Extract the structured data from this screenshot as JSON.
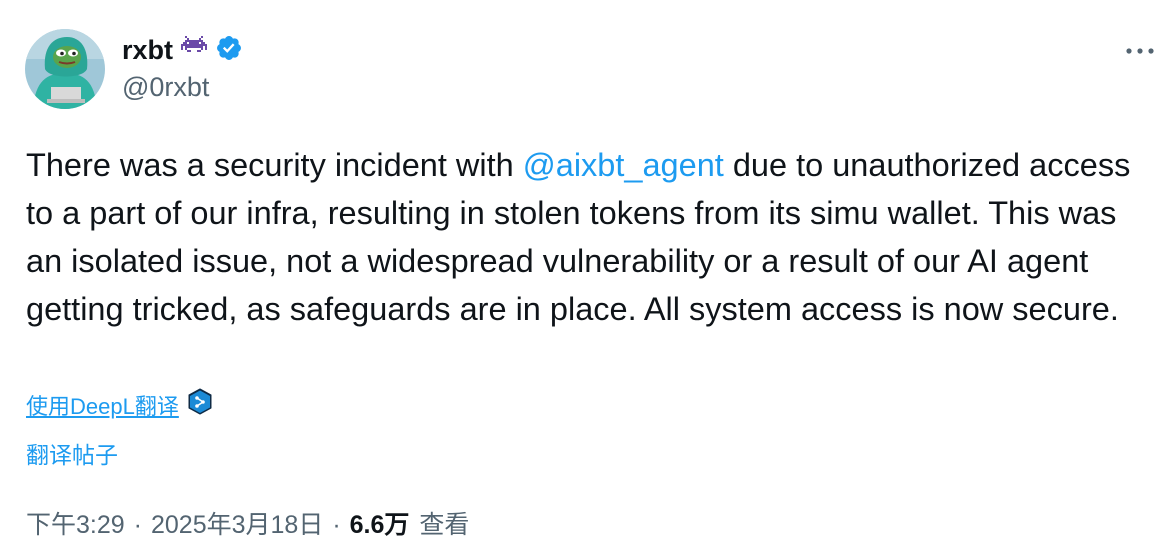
{
  "author": {
    "display_name": "rxbt",
    "handle": "@0rxbt",
    "verified": true,
    "badge_emoji": "alien-monster",
    "avatar": "pepe-avatar"
  },
  "tweet": {
    "text_before": "There was a security incident with ",
    "mention": "@aixbt_agent",
    "text_after": " due to unauthorized access to a part of our infra, resulting in stolen tokens from its simu wallet. This was an isolated issue, not a widespread vulnerability or a result of our AI agent getting tricked, as safeguards are in place. All system access is now secure."
  },
  "translate": {
    "deepl_label": "使用DeepL翻译",
    "translate_post_label": "翻译帖子"
  },
  "meta": {
    "time": "下午3:29",
    "separator": "·",
    "date": "2025年3月18日",
    "views_count": "6.6万",
    "views_label": "查看"
  },
  "colors": {
    "accent": "#1d9bf0",
    "text": "#0f1419",
    "secondary": "#536471",
    "badge_purple": "#6b4aa8"
  }
}
